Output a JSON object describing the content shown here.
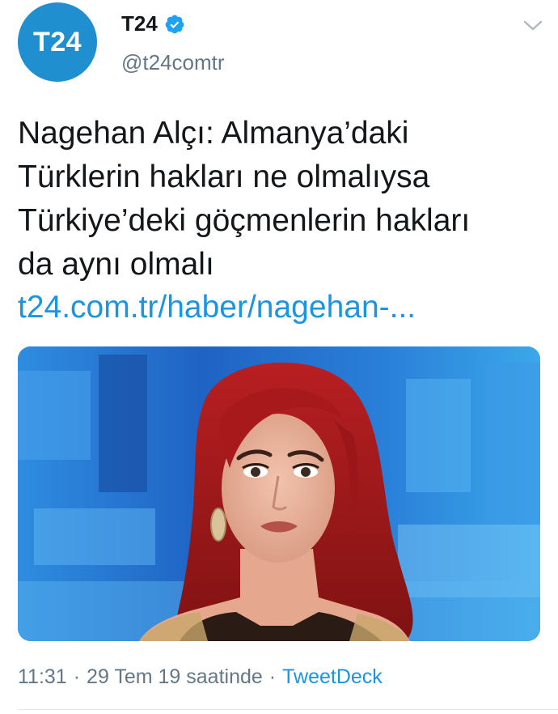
{
  "account": {
    "avatar_text": "T24",
    "display_name": "T24",
    "handle": "@t24comtr",
    "verified": true,
    "brand_color": "#1f8fd0"
  },
  "tweet": {
    "lines": [
      "Nagehan Alçı: Almanya’daki",
      "Türklerin hakları ne olmalıysa",
      "Türkiye’deki göçmenlerin hakları",
      "da aynı olmalı"
    ],
    "link": "t24.com.tr/haber/nagehan-..."
  },
  "media": {
    "icon": "photo-of-woman-with-red-hair-on-tv-studio-set"
  },
  "meta": {
    "time": "11:31",
    "separator": "·",
    "date": "29 Tem 19 saatinde",
    "source": "TweetDeck"
  },
  "colors": {
    "text": "#14171a",
    "muted": "#657786",
    "link": "#1b95e0"
  }
}
